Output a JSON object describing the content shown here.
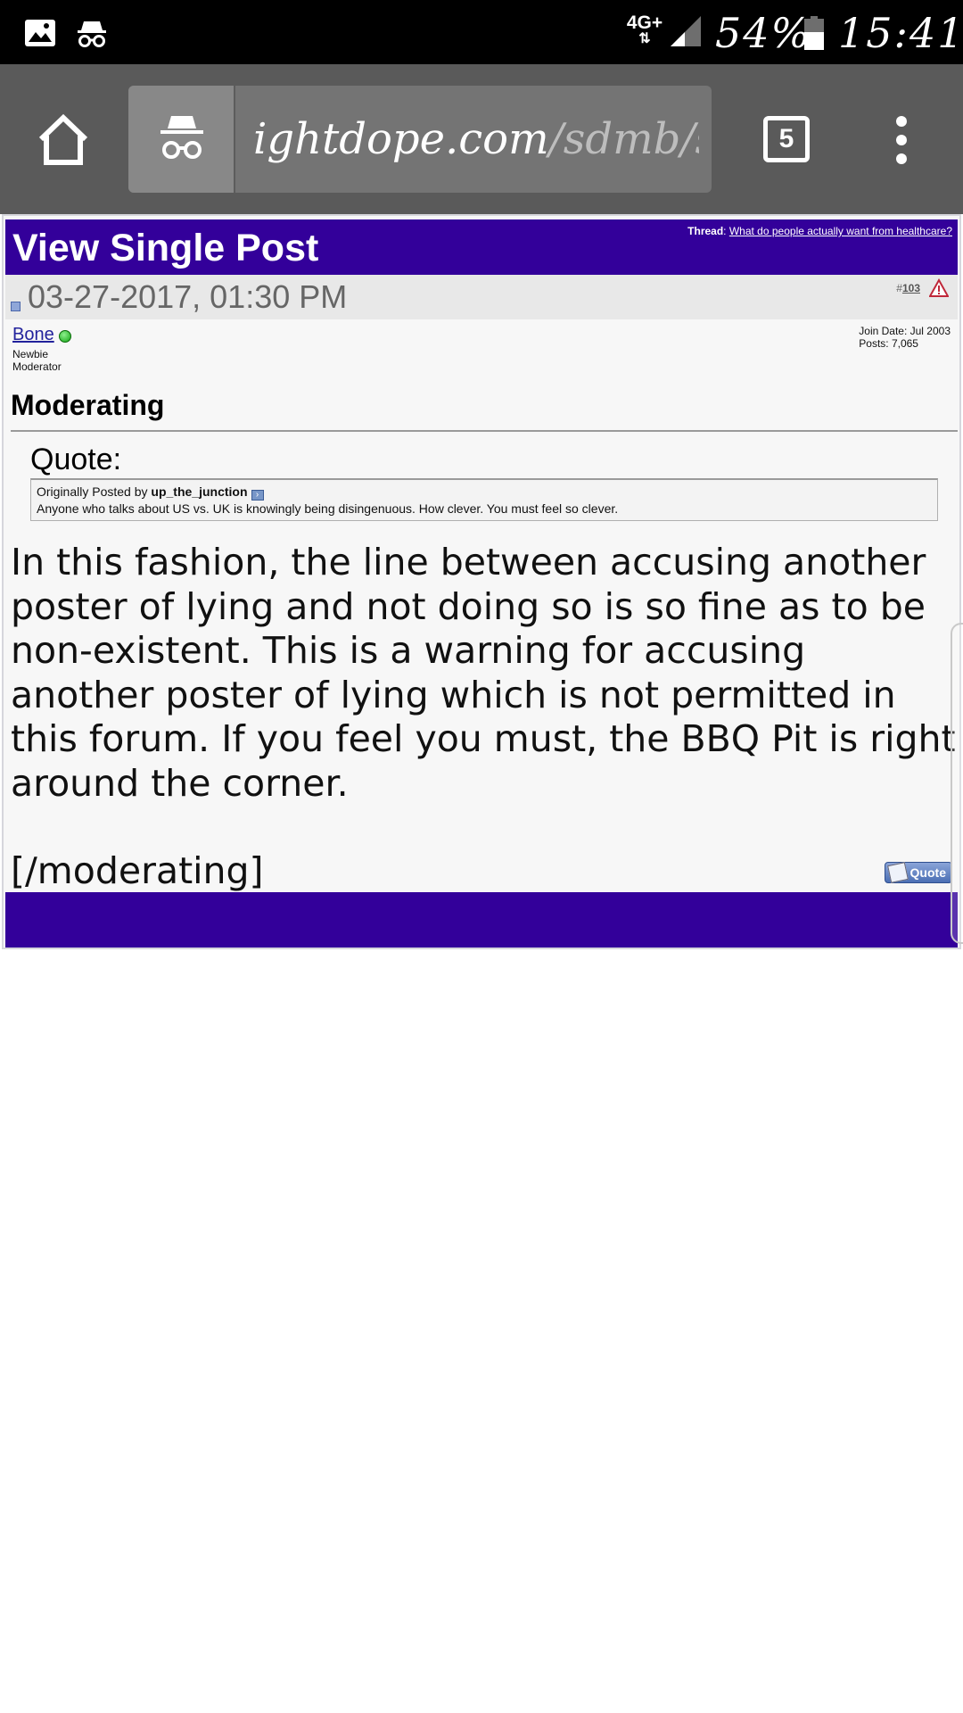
{
  "status_bar": {
    "left_icons": [
      "image-icon",
      "incognito-icon"
    ],
    "network": "4G+",
    "battery_percent": "54%",
    "time": "15:41"
  },
  "browser": {
    "url_main": "ightdope.com",
    "url_path": "/sdmb/s",
    "tab_count": "5"
  },
  "page": {
    "title": "View Single Post",
    "thread_label": "Thread",
    "thread_title": "What do people actually want from healthcare?",
    "post_date": "03-27-2017, 01:30 PM",
    "post_number_prefix": "#",
    "post_number": "103",
    "user": {
      "name": "Bone",
      "rank_line1": "Newbie",
      "rank_line2": "Moderator",
      "join_date": "Join Date: Jul 2003",
      "posts": "Posts: 7,065"
    },
    "subject": "Moderating",
    "quote_label": "Quote:",
    "quote_prefix": "Originally Posted by",
    "quote_author": "up_the_junction",
    "quote_text": "Anyone who talks about US vs. UK is knowingly being disingenuous. How clever. You must feel so clever.",
    "body_paragraph": "In this fashion, the line between accusing another poster of lying and not doing so is so fine as to be non-existent. This is a warning for accusing another poster of lying which is not permitted in this forum. If you feel you must, the BBQ Pit is right around the corner.",
    "body_closing": "[/moderating]",
    "quote_button": "Quote"
  },
  "colors": {
    "header_purple": "#33009a",
    "status_bar": "#000000",
    "toolbar": "#5a5a5a"
  }
}
